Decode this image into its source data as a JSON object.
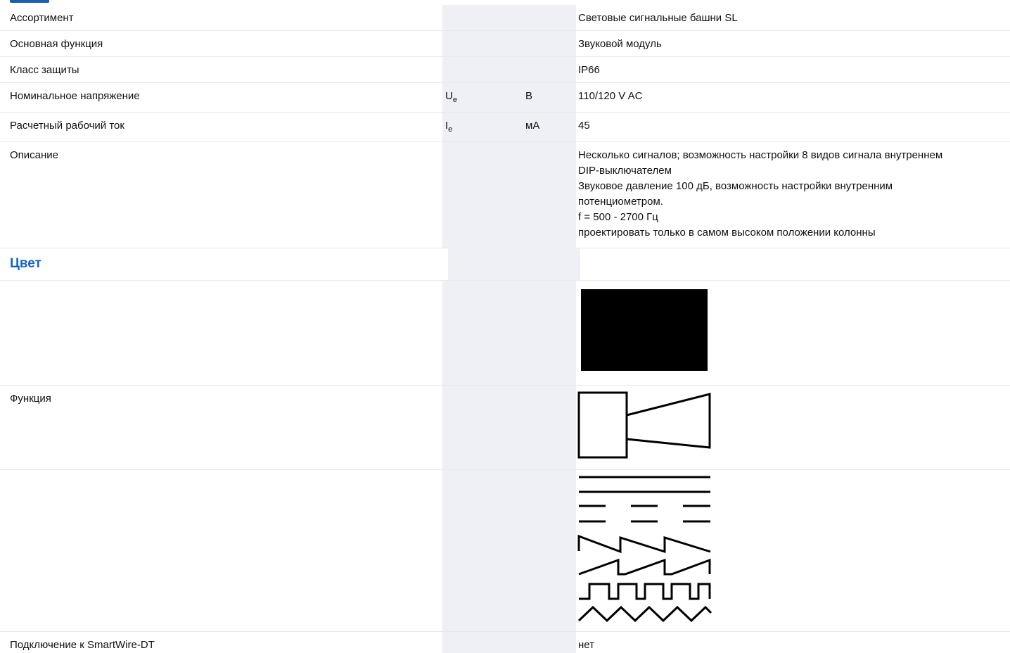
{
  "rows": {
    "assortment": {
      "label": "Ассортимент",
      "value": "Световые сигнальные башни SL"
    },
    "main_function": {
      "label": "Основная функция",
      "value": "Звуковой модуль"
    },
    "protection": {
      "label": "Класс защиты",
      "value": "IP66"
    },
    "voltage": {
      "label": "Номинальное напряжение",
      "symbol": "U",
      "symbol_sub": "e",
      "unit": "В",
      "value": "110/120 V AC"
    },
    "current": {
      "label": "Расчетный рабочий ток",
      "symbol": "I",
      "symbol_sub": "e",
      "unit": "мА",
      "value": "45"
    },
    "description": {
      "label": "Описание",
      "lines": [
        "Несколько сигналов; возможность настройки 8 видов сигнала внутреннем",
        "DIP-выключателем",
        "Звуковое давление 100 дБ, возможность настройки внутренним",
        "потенциометром.",
        "f = 500 - 2700 Гц",
        "проектировать только в самом высоком положении колонны"
      ]
    },
    "color_section": {
      "title": "Цвет"
    },
    "color_swatch": {
      "color": "#000000"
    },
    "function": {
      "label": "Функция",
      "icon": "horn-icon"
    },
    "signal_types": {
      "icon": "signal-waveforms-icon"
    },
    "smartwire": {
      "label": "Подключение к SmartWire-DT",
      "value": "нет"
    }
  }
}
